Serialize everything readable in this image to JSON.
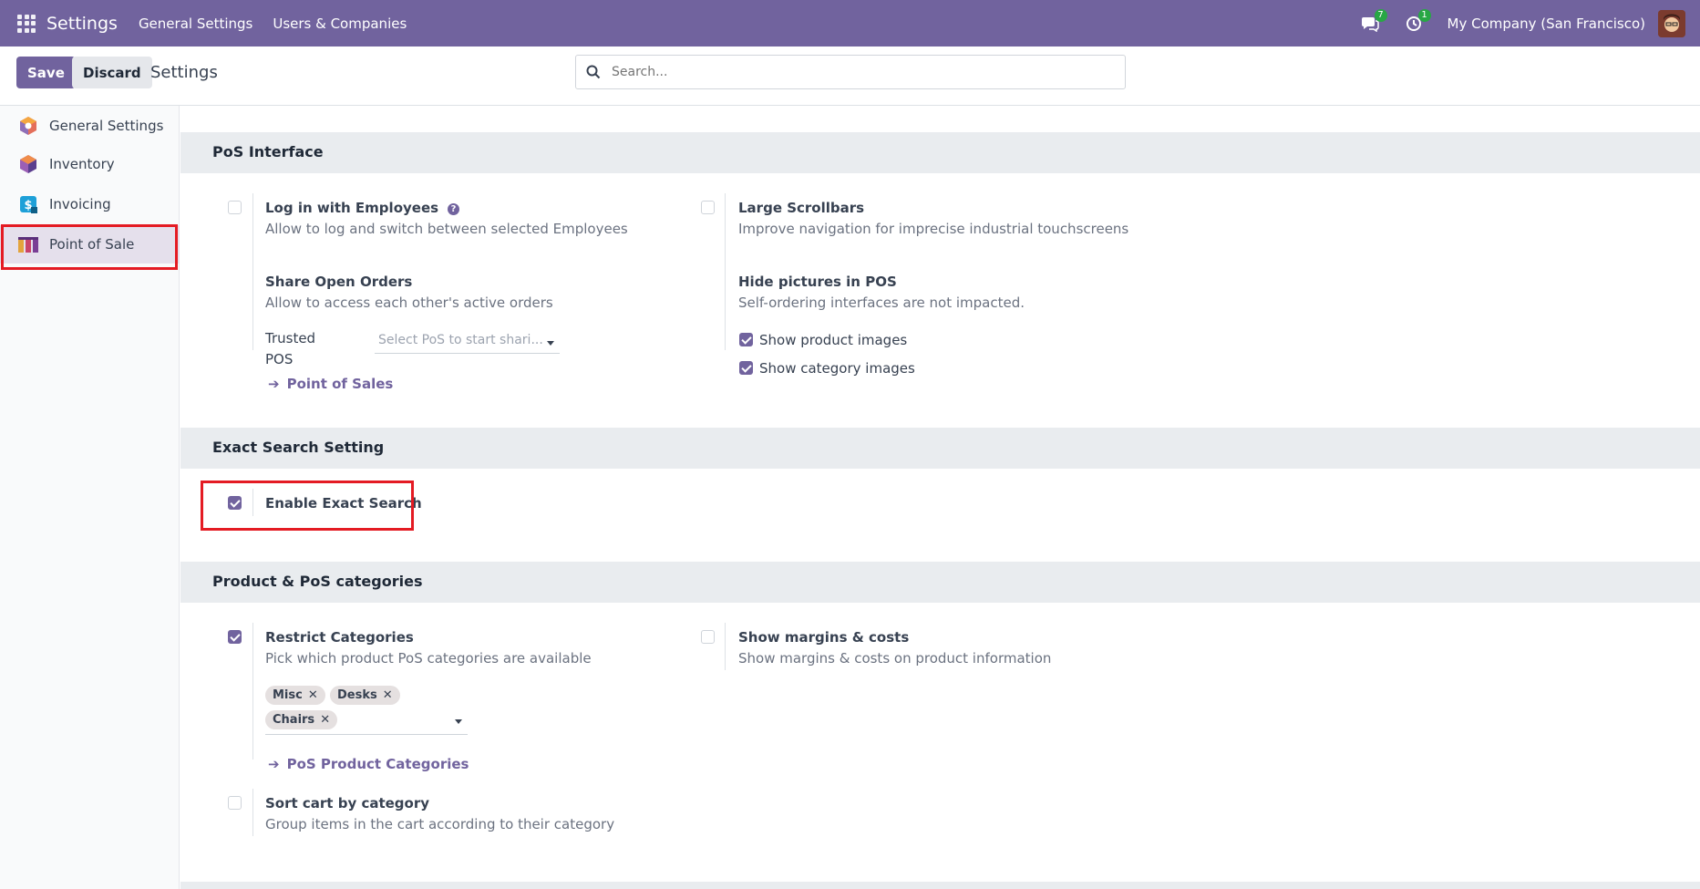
{
  "navbar": {
    "brand": "Settings",
    "links": [
      "General Settings",
      "Users & Companies"
    ],
    "messages_count": "7",
    "activities_count": "1",
    "company": "My Company (San Francisco)"
  },
  "control": {
    "save_label": "Save",
    "discard_label": "Discard",
    "title": "Settings",
    "search_placeholder": "Search..."
  },
  "sidebar": {
    "items": [
      {
        "label": "General Settings",
        "icon": "odoo-settings-icon"
      },
      {
        "label": "Inventory",
        "icon": "inventory-cube-icon"
      },
      {
        "label": "Invoicing",
        "icon": "invoicing-dollar-icon"
      },
      {
        "label": "Point of Sale",
        "icon": "point-of-sale-shop-icon",
        "active": true
      }
    ]
  },
  "sections": {
    "pos_interface": {
      "title": "PoS Interface",
      "login_employees": {
        "title": "Log in with Employees",
        "desc": "Allow to log and switch between selected Employees",
        "checked": false
      },
      "large_scrollbars": {
        "title": "Large Scrollbars",
        "desc": "Improve navigation for imprecise industrial touchscreens",
        "checked": false
      },
      "share_orders": {
        "title": "Share Open Orders",
        "desc": "Allow to access each other's active orders",
        "trusted_label_1": "Trusted",
        "trusted_label_2": "POS",
        "select_placeholder": "Select PoS to start shari...",
        "link": "Point of Sales"
      },
      "hide_pictures": {
        "title": "Hide pictures in POS",
        "desc": "Self-ordering interfaces are not impacted.",
        "show_product_images": {
          "label": "Show product images",
          "checked": true
        },
        "show_category_images": {
          "label": "Show category images",
          "checked": true
        }
      }
    },
    "exact_search": {
      "title": "Exact Search Setting",
      "enable": {
        "title": "Enable Exact Search",
        "checked": true
      }
    },
    "categories": {
      "title": "Product & PoS categories",
      "restrict": {
        "title": "Restrict Categories",
        "desc": "Pick which product PoS categories are available",
        "checked": true,
        "tags": [
          "Misc",
          "Desks",
          "Chairs"
        ],
        "link": "PoS Product Categories"
      },
      "margins": {
        "title": "Show margins & costs",
        "desc": "Show margins & costs on product information",
        "checked": false
      },
      "sort_cart": {
        "title": "Sort cart by category",
        "desc": "Group items in the cart according to their category",
        "checked": false
      }
    }
  },
  "colors": {
    "primary": "#71639e",
    "highlight": "#e41b23",
    "section_bg": "#e9ecef"
  }
}
